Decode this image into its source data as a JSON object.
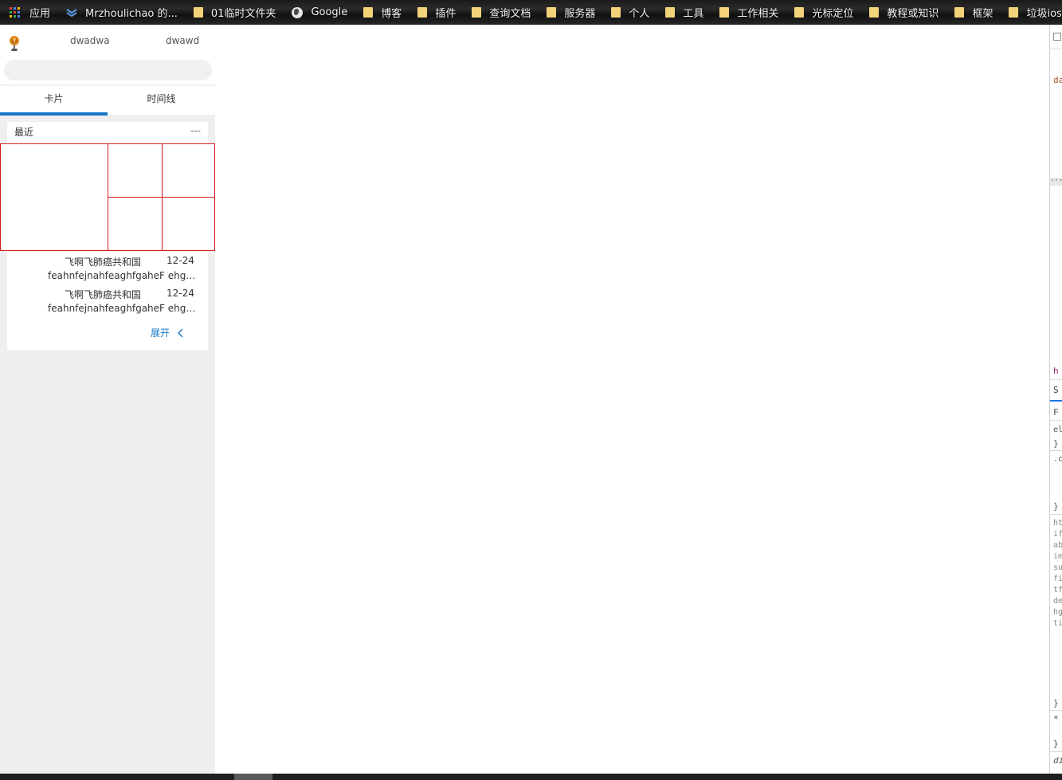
{
  "bookmarks": [
    {
      "label": "应用",
      "icon": "apps-icon"
    },
    {
      "label": "Mrzhoulichao 的...",
      "icon": "chevron-icon"
    },
    {
      "label": "01临时文件夹",
      "icon": "folder-icon"
    },
    {
      "label": "Google",
      "icon": "globe-icon"
    },
    {
      "label": "博客",
      "icon": "folder-icon"
    },
    {
      "label": "插件",
      "icon": "folder-icon"
    },
    {
      "label": "查询文档",
      "icon": "folder-icon"
    },
    {
      "label": "服务器",
      "icon": "folder-icon"
    },
    {
      "label": "个人",
      "icon": "folder-icon"
    },
    {
      "label": "工具",
      "icon": "folder-icon"
    },
    {
      "label": "工作相关",
      "icon": "folder-icon"
    },
    {
      "label": "光标定位",
      "icon": "folder-icon"
    },
    {
      "label": "教程或知识",
      "icon": "folder-icon"
    },
    {
      "label": "框架",
      "icon": "folder-icon"
    },
    {
      "label": "垃圾ios兼容问题",
      "icon": "folder-icon"
    }
  ],
  "header": {
    "user_a": "dwadwa",
    "user_b": "dwawd",
    "search_value": ""
  },
  "tabs": [
    {
      "label": "卡片",
      "active": true
    },
    {
      "label": "时间线",
      "active": false
    }
  ],
  "card": {
    "title": "最近",
    "more": "---",
    "messages": [
      {
        "name": "飞啊飞肺癌共和国",
        "date": "12-24",
        "text": "feahnfejnahfeaghfgaheF ehgafjaghdfgahdfg"
      },
      {
        "name": "飞啊飞肺癌共和国",
        "date": "12-24",
        "text": "feahnfejnahfeaghfgaheF ehgafjaghdfgahdfg"
      }
    ],
    "expand_label": "展开"
  },
  "devtools": {
    "lines": [
      "da",
      "h",
      "S",
      "F",
      "el",
      "}",
      ".c",
      "}",
      "ht",
      "if",
      "ab",
      "im",
      "su",
      "fi",
      "tf",
      "de",
      "hg",
      "ti",
      "}",
      "*",
      "}",
      "di"
    ]
  },
  "colors": {
    "accent": "#1677c6",
    "grid_border": "#d31b1b",
    "panel_bg": "#efefef",
    "folder": "#f3d37a"
  }
}
